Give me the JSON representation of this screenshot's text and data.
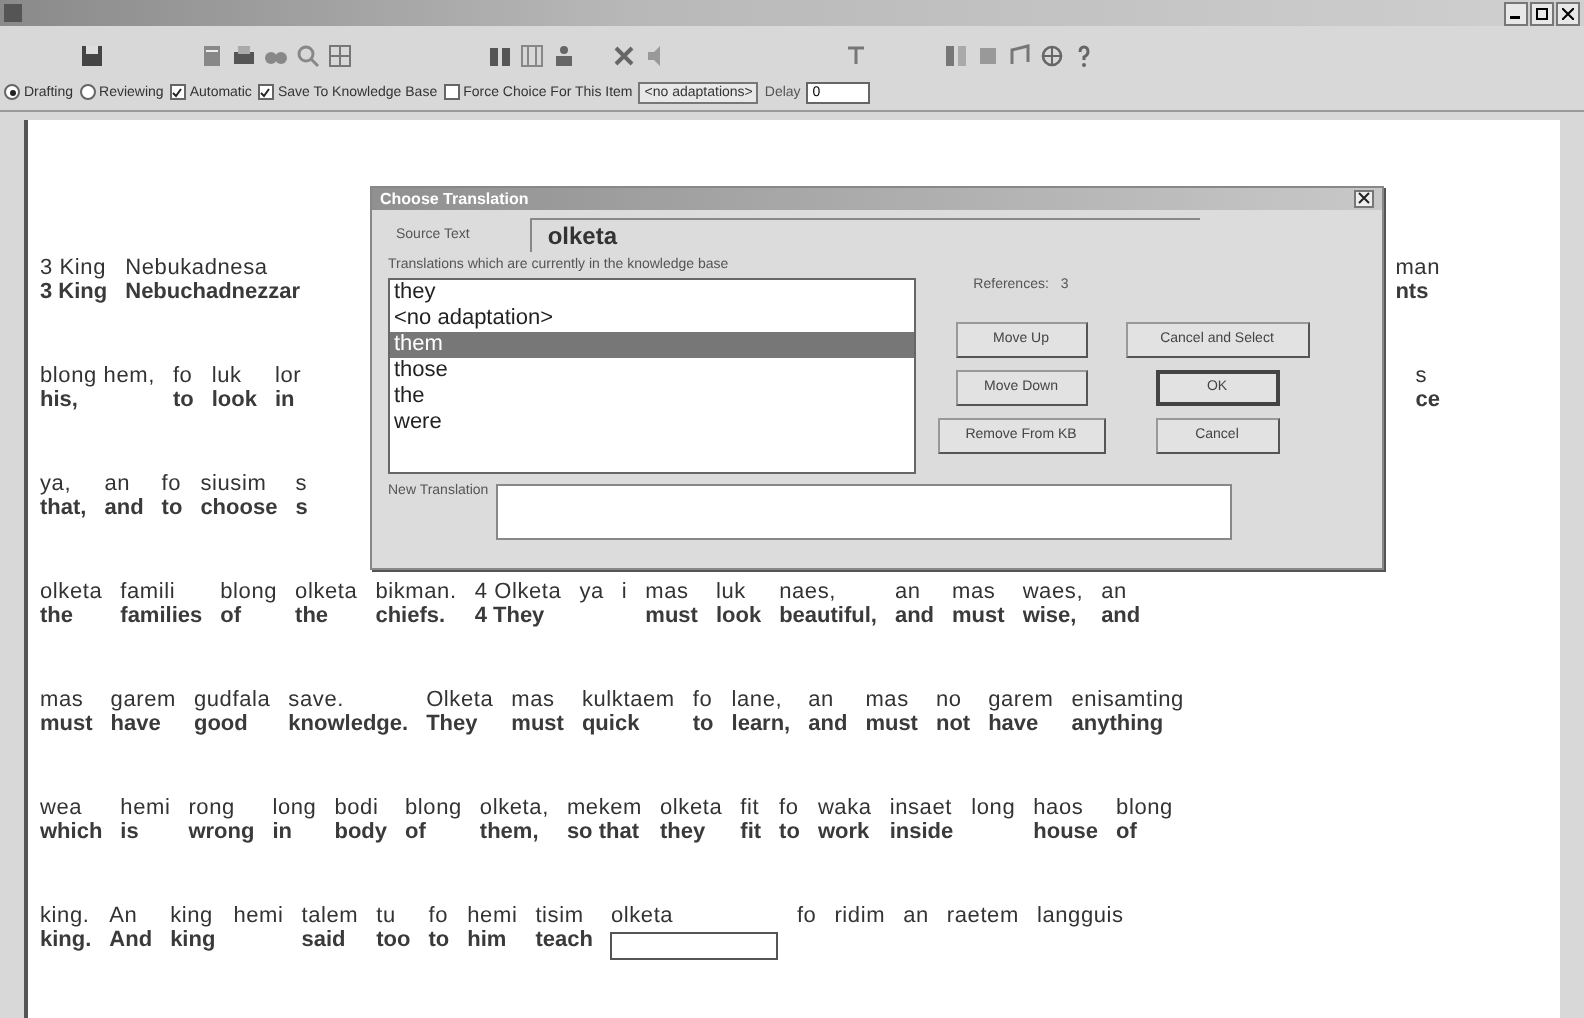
{
  "options": {
    "modes": [
      {
        "label": "Drafting",
        "selected": true
      },
      {
        "label": "Reviewing",
        "selected": false
      }
    ],
    "checks": [
      {
        "label": "Automatic",
        "checked": true
      },
      {
        "label": "Save To Knowledge Base",
        "checked": true
      },
      {
        "label": "Force Choice For This Item",
        "checked": false
      }
    ],
    "no_adaptations_button": "<no adaptations>",
    "delay_label": "Delay",
    "delay_value": "0"
  },
  "document": {
    "strips": [
      {
        "left": [
          {
            "source": "3 King",
            "target": "3 King"
          },
          {
            "source": "Nebukadnesa",
            "target": "Nebuchadnezzar"
          }
        ],
        "right": [
          {
            "source": "man",
            "target": "nts"
          }
        ]
      },
      {
        "left": [
          {
            "source": "blong hem,",
            "target": "his,"
          },
          {
            "source": "fo",
            "target": "to"
          },
          {
            "source": "luk",
            "target": "look"
          },
          {
            "source": "lor",
            "target": "in"
          }
        ],
        "right": [
          {
            "source": "s",
            "target": "ce"
          }
        ]
      },
      {
        "left": [
          {
            "source": "ya,",
            "target": "that,"
          },
          {
            "source": "an",
            "target": "and"
          },
          {
            "source": "fo",
            "target": "to"
          },
          {
            "source": "siusim",
            "target": "choose"
          },
          {
            "source": "s",
            "target": "s"
          }
        ]
      },
      {
        "left": [
          {
            "source": "olketa",
            "target": "the"
          },
          {
            "source": "famili",
            "target": "families"
          },
          {
            "source": "blong",
            "target": "of"
          },
          {
            "source": "olketa",
            "target": "the"
          },
          {
            "source": "bikman.",
            "target": "chiefs."
          },
          {
            "source": "4 Olketa",
            "target": "4 They"
          },
          {
            "source": "ya"
          },
          {
            "source": "i"
          },
          {
            "source": "mas",
            "target": "must"
          },
          {
            "source": "luk",
            "target": "look"
          },
          {
            "source": "naes,",
            "target": "beautiful,"
          },
          {
            "source": "an",
            "target": "and"
          },
          {
            "source": "mas",
            "target": "must"
          },
          {
            "source": "waes,",
            "target": "wise,"
          },
          {
            "source": "an",
            "target": "and"
          }
        ]
      },
      {
        "left": [
          {
            "source": "mas",
            "target": "must"
          },
          {
            "source": "garem",
            "target": "have"
          },
          {
            "source": "gudfala",
            "target": "good"
          },
          {
            "source": "save.",
            "target": "knowledge."
          },
          {
            "source": "Olketa",
            "target": "They"
          },
          {
            "source": "mas",
            "target": "must"
          },
          {
            "source": "kulktaem",
            "target": "quick"
          },
          {
            "source": "fo",
            "target": "to"
          },
          {
            "source": "lane,",
            "target": "learn,"
          },
          {
            "source": "an",
            "target": "and"
          },
          {
            "source": "mas",
            "target": "must"
          },
          {
            "source": "no",
            "target": "not"
          },
          {
            "source": "garem",
            "target": "have"
          },
          {
            "source": "enisamting",
            "target": "anything"
          }
        ]
      },
      {
        "left": [
          {
            "source": "wea",
            "target": "which"
          },
          {
            "source": "hemi",
            "target": "is"
          },
          {
            "source": "rong",
            "target": "wrong"
          },
          {
            "source": "long",
            "target": "in"
          },
          {
            "source": "bodi",
            "target": "body"
          },
          {
            "source": "blong",
            "target": "of"
          },
          {
            "source": "olketa,",
            "target": "them,"
          },
          {
            "source": "mekem",
            "target": "so that"
          },
          {
            "source": "olketa",
            "target": "they"
          },
          {
            "source": "fit",
            "target": "fit"
          },
          {
            "source": "fo",
            "target": "to"
          },
          {
            "source": "waka",
            "target": "work"
          },
          {
            "source": "insaet",
            "target": "inside"
          },
          {
            "source": "long"
          },
          {
            "source": "haos",
            "target": "house"
          },
          {
            "source": "blong",
            "target": "of"
          }
        ]
      },
      {
        "left": [
          {
            "source": "king.",
            "target": "king."
          },
          {
            "source": "An",
            "target": "And"
          },
          {
            "source": "king",
            "target": "king"
          },
          {
            "source": "hemi"
          },
          {
            "source": "talem",
            "target": "said"
          },
          {
            "source": "tu",
            "target": "too"
          },
          {
            "source": "fo",
            "target": "to"
          },
          {
            "source": "hemi",
            "target": "him"
          },
          {
            "source": "tisim",
            "target": "teach"
          },
          {
            "source": "olketa",
            "kind": "entry"
          },
          {
            "source": "fo"
          },
          {
            "source": "ridim"
          },
          {
            "source": "an"
          },
          {
            "source": "raetem"
          },
          {
            "source": "langguis"
          }
        ]
      }
    ]
  },
  "dialog": {
    "title": "Choose Translation",
    "source_label": "Source Text",
    "source_value": "olketa",
    "list_label": "Translations which are currently in the knowledge base",
    "translations": [
      {
        "text": "they",
        "selected": false
      },
      {
        "text": "<no adaptation>",
        "selected": false
      },
      {
        "text": "them",
        "selected": true
      },
      {
        "text": "those",
        "selected": false
      },
      {
        "text": "the",
        "selected": false
      },
      {
        "text": "were",
        "selected": false
      }
    ],
    "references_label": "References:",
    "references_value": "3",
    "buttons": {
      "move_up": "Move Up",
      "move_down": "Move Down",
      "remove": "Remove From KB",
      "cancel_select": "Cancel and Select",
      "ok": "OK",
      "cancel": "Cancel"
    },
    "new_label": "New Translation"
  }
}
